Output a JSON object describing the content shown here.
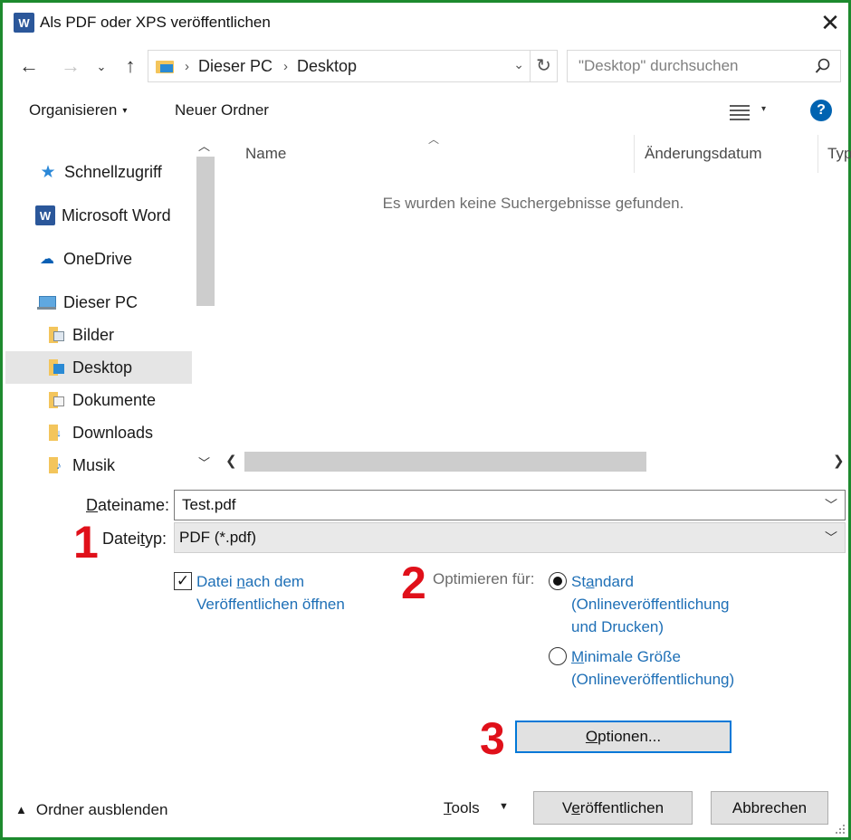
{
  "window": {
    "title": "Als PDF oder XPS veröffentlichen",
    "app_icon_letter": "W",
    "close_glyph": "✕",
    "border_color": "#1d8a2e"
  },
  "nav": {
    "back_glyph": "←",
    "forward_glyph": "→",
    "recent_glyph": "⌄",
    "up_glyph": "↑"
  },
  "address_bar": {
    "crumbs": [
      "Dieser PC",
      "Desktop"
    ],
    "separator": "›",
    "dropdown_glyph": "⌄",
    "refresh_glyph": "↻"
  },
  "search": {
    "placeholder": "\"Desktop\" durchsuchen",
    "icon": "magnifier-icon"
  },
  "toolbar": {
    "organize_label": "Organisieren",
    "caret": "▾",
    "new_folder_label": "Neuer Ordner",
    "help_glyph": "?"
  },
  "sidebar": {
    "items": [
      {
        "label": "Schnellzugriff",
        "icon": "star-icon"
      },
      {
        "label": "Microsoft Word",
        "icon": "word-icon"
      },
      {
        "label": "OneDrive",
        "icon": "cloud-icon"
      },
      {
        "label": "Dieser PC",
        "icon": "computer-icon"
      },
      {
        "label": "Bilder",
        "icon": "pictures-folder-icon"
      },
      {
        "label": "Desktop",
        "icon": "desktop-folder-icon",
        "selected": true
      },
      {
        "label": "Dokumente",
        "icon": "documents-folder-icon"
      },
      {
        "label": "Downloads",
        "icon": "downloads-folder-icon"
      },
      {
        "label": "Musik",
        "icon": "music-folder-icon"
      }
    ]
  },
  "file_list": {
    "columns": [
      "Name",
      "Änderungsdatum",
      "Typ"
    ],
    "empty_message": "Es wurden keine Suchergebnisse gefunden."
  },
  "form": {
    "filename_label_ul": "D",
    "filename_label_rest": "ateiname:",
    "filename_value": "Test.pdf",
    "filetype_label_start": "Datei",
    "filetype_label_ul": "t",
    "filetype_label_rest": "yp:",
    "filetype_value": "PDF (*.pdf)",
    "open_after_publish": {
      "checked": true,
      "label_start": "Datei ",
      "label_ul": "n",
      "label_rest": "ach dem Veröffentlichen öffnen"
    },
    "optimize_label": "Optimieren für:",
    "optimize_options": [
      {
        "label_start": "St",
        "label_ul": "a",
        "label_rest": "ndard (Onlineveröffentlichung und Drucken)",
        "selected": true
      },
      {
        "label_start": "",
        "label_ul": "M",
        "label_rest": "inimale Größe (Onlineveröffentlichung)",
        "selected": false
      }
    ],
    "options_button_ul": "O",
    "options_button_rest": "ptionen..."
  },
  "annotations": [
    "1",
    "2",
    "3"
  ],
  "footer": {
    "hide_folders_label": "Ordner ausblenden",
    "hide_folders_caret": "▲",
    "tools_ul": "T",
    "tools_rest": "ools",
    "publish_start": "V",
    "publish_ul": "e",
    "publish_rest": "röffentlichen",
    "cancel_label": "Abbrechen"
  },
  "colors": {
    "accent": "#0078d7",
    "link": "#1e6fb6",
    "annotation": "#e0101a",
    "selection": "#e5e5e5"
  }
}
